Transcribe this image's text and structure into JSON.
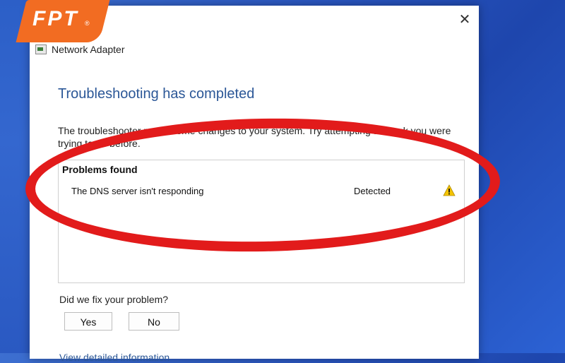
{
  "logo": {
    "text": "FPT",
    "reg": "®"
  },
  "window": {
    "title": "Network Adapter",
    "close_glyph": "✕",
    "heading": "Troubleshooting has completed",
    "description": "The troubleshooter made some changes to your system. Try attempting the task you were trying to do before."
  },
  "problems": {
    "title": "Problems found",
    "items": [
      {
        "name": "The DNS server isn't responding",
        "status": "Detected",
        "icon": "warning-icon"
      }
    ]
  },
  "feedback": {
    "question": "Did we fix your problem?",
    "yes_label": "Yes",
    "no_label": "No"
  },
  "link": {
    "label": "View detailed information"
  },
  "colors": {
    "accent": "#2b5797",
    "highlight_oval": "#e21b1b",
    "logo": "#f26c22",
    "warning": "#f5c400"
  }
}
